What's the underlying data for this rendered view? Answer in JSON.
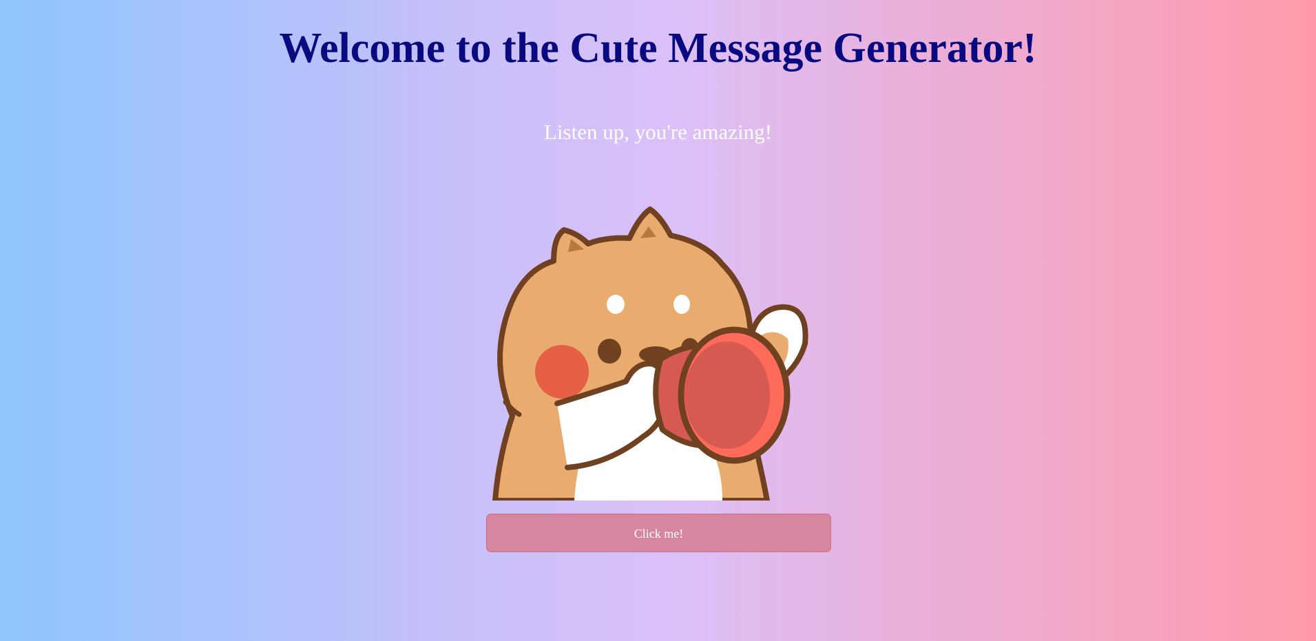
{
  "header": {
    "title": "Welcome to the Cute Message Generator!"
  },
  "message": {
    "text": "Listen up, you're amazing!"
  },
  "illustration": {
    "icon": "shiba-megaphone-illustration",
    "colors": {
      "fur": "#e9ab6e",
      "outline": "#6f4120",
      "cheek": "#e45f45",
      "megaphone": "#d65a52",
      "white": "#ffffff"
    }
  },
  "action": {
    "button_label": "Click me!"
  },
  "theme": {
    "title_color": "#0a0a80",
    "gradient_start": "#8ec5fc",
    "gradient_end": "#ff9aaa",
    "button_color": "#d6869f"
  }
}
